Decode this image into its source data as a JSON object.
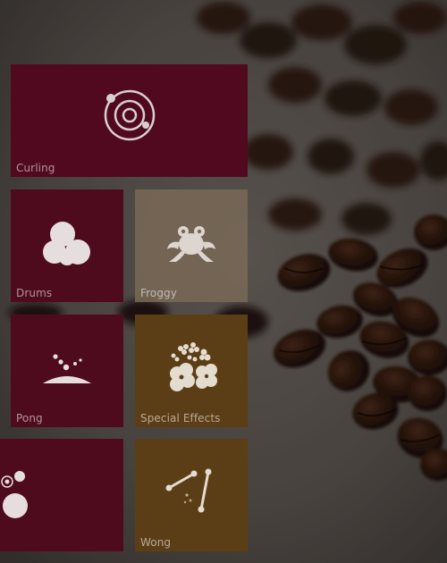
{
  "tiles": [
    {
      "id": "curling",
      "label": "Curling",
      "icon": "curling-stone-icon"
    },
    {
      "id": "drums",
      "label": "Drums",
      "icon": "drums-icon"
    },
    {
      "id": "froggy",
      "label": "Froggy",
      "icon": "frog-icon"
    },
    {
      "id": "pong",
      "label": "Pong",
      "icon": "pong-icon"
    },
    {
      "id": "special_effects",
      "label": "Special Effects",
      "icon": "flowers-icon"
    },
    {
      "id": "bubbles",
      "label": "",
      "icon": "bubbles-icon"
    },
    {
      "id": "wong",
      "label": "Wong",
      "icon": "sticks-icon"
    }
  ],
  "colors": {
    "maroon": "#4f0b1e",
    "froggy": "#796856",
    "amber": "#5c3e16",
    "label": "#ffffff"
  }
}
